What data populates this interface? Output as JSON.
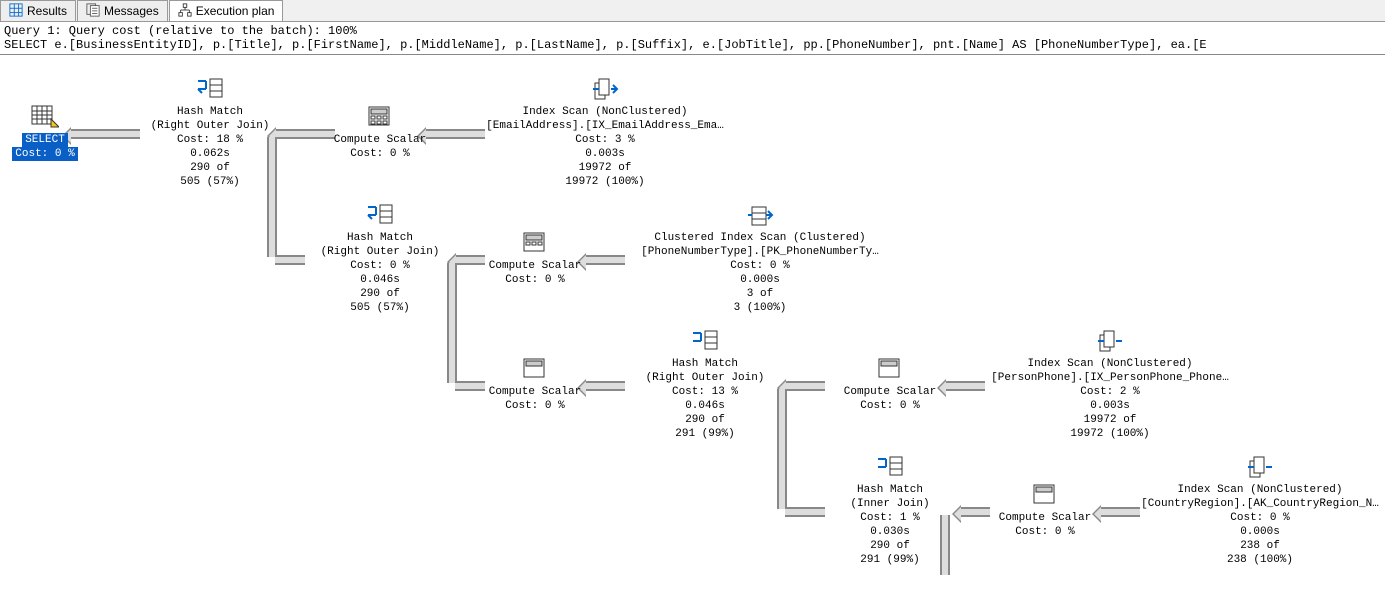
{
  "tabs": {
    "results": "Results",
    "messages": "Messages",
    "plan": "Execution plan"
  },
  "header": {
    "line1": "Query 1: Query cost (relative to the batch): 100%",
    "line2": "SELECT e.[BusinessEntityID], p.[Title], p.[FirstName], p.[MiddleName], p.[LastName], p.[Suffix], e.[JobTitle], pp.[PhoneNumber], pnt.[Name] AS [PhoneNumberType], ea.[E"
  },
  "select_node": {
    "label": "SELECT",
    "cost": "Cost: 0 %"
  },
  "hash1": {
    "t": "Hash Match",
    "sub": "(Right Outer Join)",
    "cost": "Cost: 18 %",
    "time": "0.062s",
    "rows1": "290 of",
    "rows2": "505 (57%)"
  },
  "cs1": {
    "t": "Compute Scalar",
    "cost": "Cost: 0 %"
  },
  "scan1": {
    "t": "Index Scan (NonClustered)",
    "sub": "[EmailAddress].[IX_EmailAddress_Ema…",
    "cost": "Cost: 3 %",
    "time": "0.003s",
    "rows1": "19972 of",
    "rows2": "19972 (100%)"
  },
  "hash2": {
    "t": "Hash Match",
    "sub": "(Right Outer Join)",
    "cost": "Cost: 0 %",
    "time": "0.046s",
    "rows1": "290 of",
    "rows2": "505 (57%)"
  },
  "cs2": {
    "t": "Compute Scalar",
    "cost": "Cost: 0 %"
  },
  "scan2": {
    "t": "Clustered Index Scan (Clustered)",
    "sub": "[PhoneNumberType].[PK_PhoneNumberTy…",
    "cost": "Cost: 0 %",
    "time": "0.000s",
    "rows1": "3 of",
    "rows2": "3 (100%)"
  },
  "cs3": {
    "t": "Compute Scalar",
    "cost": "Cost: 0 %"
  },
  "hash3": {
    "t": "Hash Match",
    "sub": "(Right Outer Join)",
    "cost": "Cost: 13 %",
    "time": "0.046s",
    "rows1": "290 of",
    "rows2": "291 (99%)"
  },
  "cs4": {
    "t": "Compute Scalar",
    "cost": "Cost: 0 %"
  },
  "scan3": {
    "t": "Index Scan (NonClustered)",
    "sub": "[PersonPhone].[IX_PersonPhone_Phone…",
    "cost": "Cost: 2 %",
    "time": "0.003s",
    "rows1": "19972 of",
    "rows2": "19972 (100%)"
  },
  "hash4": {
    "t": "Hash Match",
    "sub": "(Inner Join)",
    "cost": "Cost: 1 %",
    "time": "0.030s",
    "rows1": "290 of",
    "rows2": "291 (99%)"
  },
  "cs5": {
    "t": "Compute Scalar",
    "cost": "Cost: 0 %"
  },
  "scan4": {
    "t": "Index Scan (NonClustered)",
    "sub": "[CountryRegion].[AK_CountryRegion_N…",
    "cost": "Cost: 0 %",
    "time": "0.000s",
    "rows1": "238 of",
    "rows2": "238 (100%)"
  }
}
